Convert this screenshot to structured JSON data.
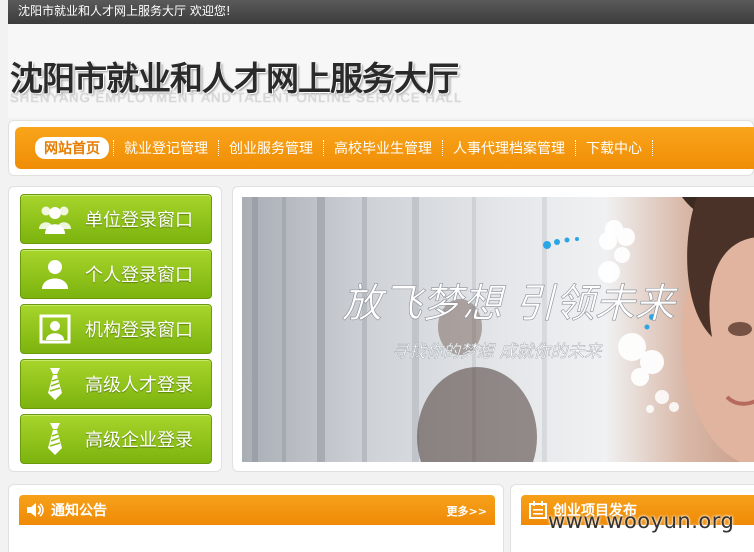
{
  "topbar": {
    "welcome": "沈阳市就业和人才网上服务大厅 欢迎您!"
  },
  "header": {
    "title": "沈阳市就业和人才网上服务大厅",
    "subtitle": "SHENYANG EMPLOYMENT AND TALENT ONLINE SERVICE HALL"
  },
  "nav": {
    "items": [
      {
        "label": "网站首页"
      },
      {
        "label": "就业登记管理"
      },
      {
        "label": "创业服务管理"
      },
      {
        "label": "高校毕业生管理"
      },
      {
        "label": "人事代理档案管理"
      },
      {
        "label": "下载中心"
      }
    ]
  },
  "login": {
    "buttons": [
      {
        "label": "单位登录窗口",
        "icon": "group-icon"
      },
      {
        "label": "个人登录窗口",
        "icon": "person-icon"
      },
      {
        "label": "机构登录窗口",
        "icon": "id-card-icon"
      },
      {
        "label": "高级人才登录",
        "icon": "tie-icon"
      },
      {
        "label": "高级企业登录",
        "icon": "tie-icon"
      }
    ]
  },
  "banner": {
    "slogan": "放飞梦想 引领未来",
    "tagline": "寻找你的梦想 成就你的未来"
  },
  "panels": {
    "notice": {
      "title": "通知公告",
      "more": "更多>>"
    },
    "startup": {
      "title": "创业项目发布"
    }
  },
  "watermark": "www.wooyun.org",
  "colors": {
    "accent": "#f29a10",
    "green": "#8cc11b",
    "topbar": "#4a4a4a"
  }
}
